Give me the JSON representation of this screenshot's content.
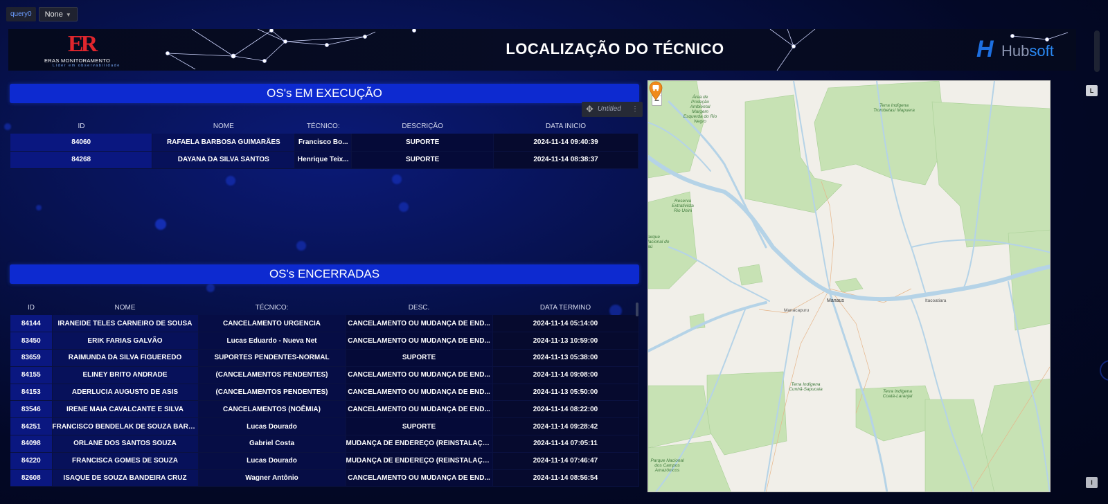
{
  "query_bar": {
    "query_label": "query0",
    "select_value": "None"
  },
  "header": {
    "title": "LOCALIZAÇÃO DO TÉCNICO",
    "left_logo": {
      "mark": "ER",
      "name": "ERAS MONITORAMENTO",
      "tagline": "Líder em observabilidade"
    },
    "right_logo": {
      "name_prefix": "Hub",
      "name_suffix": "soft"
    }
  },
  "executing": {
    "title": "OS's EM EXECUÇÃO",
    "columns": [
      "ID",
      "NOME",
      "TÉCNICO:",
      "DESCRIÇÃO",
      "DATA INICIO"
    ],
    "rows": [
      [
        "84060",
        "RAFAELA BARBOSA GUIMARÃES",
        "Francisco Bo...",
        "SUPORTE",
        "2024-11-14 09:40:39"
      ],
      [
        "84268",
        "DAYANA DA SILVA SANTOS",
        "Henrique Teix...",
        "SUPORTE",
        "2024-11-14 08:38:37"
      ]
    ],
    "panel_chip": "Untitled"
  },
  "closed": {
    "title": "OS's ENCERRADAS",
    "columns": [
      "ID",
      "NOME",
      "TÉCNICO:",
      "DESC.",
      "DATA TERMINO"
    ],
    "rows": [
      [
        "84144",
        "IRANEIDE TELES CARNEIRO DE SOUSA",
        "CANCELAMENTO URGENCIA",
        "CANCELAMENTO OU MUDANÇA DE END...",
        "2024-11-14 05:14:00"
      ],
      [
        "83450",
        "ERIK FARIAS GALVÃO",
        "Lucas Eduardo - Nueva Net",
        "CANCELAMENTO OU MUDANÇA DE END...",
        "2024-11-13 10:59:00"
      ],
      [
        "83659",
        "RAIMUNDA DA SILVA FIGUEREDO",
        "SUPORTES PENDENTES-NORMAL",
        "SUPORTE",
        "2024-11-13 05:38:00"
      ],
      [
        "84155",
        "ELINEY BRITO ANDRADE",
        "(CANCELAMENTOS PENDENTES)",
        "CANCELAMENTO OU MUDANÇA DE END...",
        "2024-11-14 09:08:00"
      ],
      [
        "84153",
        "ADERLUCIA AUGUSTO DE ASIS",
        "(CANCELAMENTOS PENDENTES)",
        "CANCELAMENTO OU MUDANÇA DE END...",
        "2024-11-13 05:50:00"
      ],
      [
        "83546",
        "IRENE MAIA CAVALCANTE E SILVA",
        "CANCELAMENTOS (NOÊMIA)",
        "CANCELAMENTO OU MUDANÇA DE END...",
        "2024-11-14 08:22:00"
      ],
      [
        "84251",
        "FRANCISCO BENDELAK DE SOUZA BARB...",
        "Lucas Dourado",
        "SUPORTE",
        "2024-11-14 09:28:42"
      ],
      [
        "84098",
        "ORLANE DOS SANTOS SOUZA",
        "Gabriel Costa",
        "MUDANÇA DE ENDEREÇO (REINSTALAÇÃ...",
        "2024-11-14 07:05:11"
      ],
      [
        "84220",
        "FRANCISCA GOMES DE SOUZA",
        "Lucas Dourado",
        "MUDANÇA DE ENDEREÇO (REINSTALAÇÃ...",
        "2024-11-14 07:46:47"
      ],
      [
        "82608",
        "ISAQUE DE SOUZA BANDEIRA CRUZ",
        "Wagner Antônio",
        "CANCELAMENTO OU MUDANÇA DE END...",
        "2024-11-14 08:56:54"
      ]
    ]
  },
  "map": {
    "zoom_in": "+",
    "zoom_out": "−",
    "city": "Manaus",
    "labels": [
      "Área de Proteção Ambiental Margem Esquerda do Rio Negro",
      "Terra Indígena Trombetas/ Mapuera",
      "Reserva Extrativista Rio Unini",
      "Parque Nacional do Jaú",
      "Terra Indígena Coatá-Laranjal",
      "Terra Indígena Cunhã-Sapucaia",
      "Parque Nacional dos Campos Amazônicos"
    ],
    "towns": [
      "Itacoatiara",
      "Manacapuru"
    ],
    "pin_icon": "technician-pin-icon"
  },
  "side_buttons": [
    "L",
    "I"
  ],
  "colors": {
    "section_header": "#0d2ad0",
    "pin": "#f08a1c",
    "forest": "#c7e2b4",
    "river": "#b5d3e7"
  }
}
